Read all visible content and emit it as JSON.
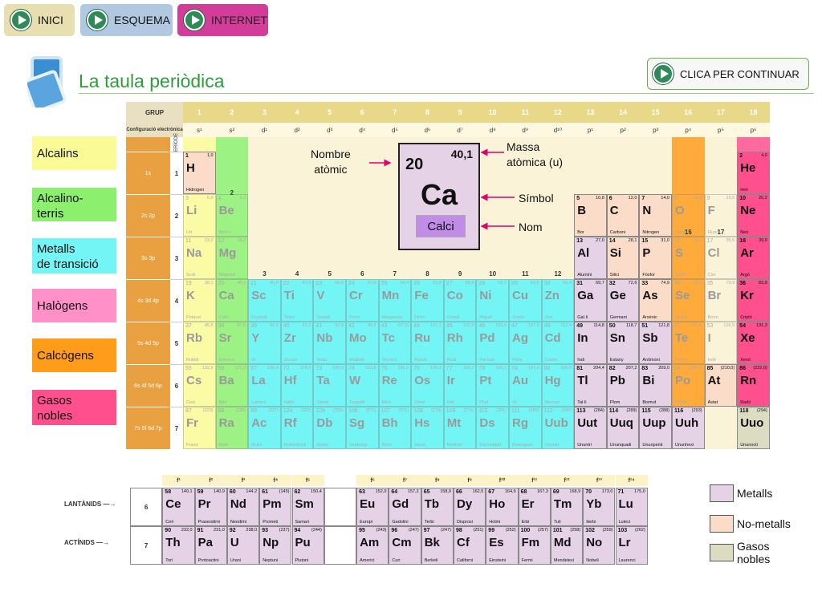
{
  "nav": {
    "inici": "INICI",
    "esquema": "ESQUEMA",
    "internet": "INTERNET"
  },
  "title": "La taula periòdica",
  "continue_label": "CLICA PER CONTINUAR",
  "legend_left": [
    "Alcalins",
    "Alcalino-\nterris",
    "Metalls\nde transició",
    "Halògens",
    "Calcògens",
    "Gasos\nnobles"
  ],
  "legend_right": [
    "Metalls",
    "No-metalls",
    "Gasos\nnobles"
  ],
  "colors": {
    "alkali": "#fafa96",
    "alkaline": "#8cf06e",
    "transition": "#73f5f5",
    "halogen": "#ff91c8",
    "chalcogen": "#ff9c19",
    "noble": "#ff4f8c",
    "metal": "#e6d2e6",
    "nonmetal": "#fadcc8",
    "noblegas": "#dcdcc3",
    "accent": "#2f9e3a"
  },
  "table_headers": {
    "grup": "GRUP",
    "config": "Configuració electrònica",
    "orbitals": "ORBITALS",
    "periode": "PERÍODE",
    "groups": [
      "1",
      "2",
      "3",
      "4",
      "5",
      "6",
      "7",
      "8",
      "9",
      "10",
      "11",
      "12",
      "13",
      "14",
      "15",
      "16",
      "17",
      "18"
    ],
    "configs": [
      "s¹",
      "s²",
      "d¹",
      "d²",
      "d³",
      "d⁴",
      "d⁵",
      "d⁶",
      "d⁷",
      "d⁸",
      "d⁹",
      "d¹⁰",
      "p¹",
      "p²",
      "p³",
      "p⁴",
      "p⁵",
      "p⁶"
    ],
    "orbital_rows": [
      "1s",
      "2s 2p",
      "3s 3p",
      "4s 3d 4p",
      "5s 4d 5p",
      "6s 4f 5d 6p",
      "7s 5f 6d 7p"
    ],
    "periods": [
      "1",
      "2",
      "3",
      "4",
      "5",
      "6",
      "7"
    ],
    "inner_group_labels": [
      "1",
      "2",
      "13",
      "14",
      "15",
      "16",
      "17",
      "18",
      "3",
      "4",
      "5",
      "6",
      "7",
      "8",
      "9",
      "10",
      "11",
      "12"
    ],
    "f_headers": [
      "f¹",
      "f²",
      "f³",
      "f⁴",
      "f⁵",
      "f⁶",
      "f⁷",
      "f⁸",
      "f⁹",
      "f¹⁰",
      "f¹¹",
      "f¹²",
      "f¹³",
      "f¹⁴"
    ]
  },
  "elements": [
    {
      "n": "1",
      "m": "1,0",
      "s": "H",
      "name": "Hidrogen",
      "p": 1,
      "g": 1,
      "c": "nonmetal"
    },
    {
      "n": "2",
      "m": "4,0",
      "s": "He",
      "name": "Heli",
      "p": 1,
      "g": 18,
      "c": "noble"
    },
    {
      "n": "3",
      "m": "6,9",
      "s": "Li",
      "name": "Liti",
      "p": 2,
      "g": 1,
      "c": "alkali",
      "ghost": true
    },
    {
      "n": "4",
      "m": "9,0",
      "s": "Be",
      "name": "Beril·li",
      "p": 2,
      "g": 2,
      "c": "alkaline",
      "ghost": true
    },
    {
      "n": "5",
      "m": "10,8",
      "s": "B",
      "name": "Bor",
      "p": 2,
      "g": 13,
      "c": "nonmetal"
    },
    {
      "n": "6",
      "m": "12,0",
      "s": "C",
      "name": "Carboni",
      "p": 2,
      "g": 14,
      "c": "nonmetal"
    },
    {
      "n": "7",
      "m": "14,0",
      "s": "N",
      "name": "Nitrogen",
      "p": 2,
      "g": 15,
      "c": "nonmetal"
    },
    {
      "n": "8",
      "m": "16,0",
      "s": "O",
      "name": "Oxigen",
      "p": 2,
      "g": 16,
      "c": "chalcogen",
      "ghost": true
    },
    {
      "n": "9",
      "m": "19,0",
      "s": "F",
      "name": "Fluor",
      "p": 2,
      "g": 17,
      "c": "halogen",
      "ghost": true
    },
    {
      "n": "10",
      "m": "20,2",
      "s": "Ne",
      "name": "Neó",
      "p": 2,
      "g": 18,
      "c": "noble"
    },
    {
      "n": "11",
      "m": "23,0",
      "s": "Na",
      "name": "Sodi",
      "p": 3,
      "g": 1,
      "c": "alkali",
      "ghost": true
    },
    {
      "n": "12",
      "m": "24,3",
      "s": "Mg",
      "name": "Magnesi",
      "p": 3,
      "g": 2,
      "c": "alkaline",
      "ghost": true
    },
    {
      "n": "13",
      "m": "27,0",
      "s": "Al",
      "name": "Alumini",
      "p": 3,
      "g": 13,
      "c": "metal"
    },
    {
      "n": "14",
      "m": "28,1",
      "s": "Si",
      "name": "Silici",
      "p": 3,
      "g": 14,
      "c": "nonmetal"
    },
    {
      "n": "15",
      "m": "31,0",
      "s": "P",
      "name": "Fòsfor",
      "p": 3,
      "g": 15,
      "c": "nonmetal"
    },
    {
      "n": "16",
      "m": "32,1",
      "s": "S",
      "name": "Sofre",
      "p": 3,
      "g": 16,
      "c": "chalcogen",
      "ghost": true
    },
    {
      "n": "17",
      "m": "35,5",
      "s": "Cl",
      "name": "Clor",
      "p": 3,
      "g": 17,
      "c": "halogen",
      "ghost": true
    },
    {
      "n": "18",
      "m": "39,9",
      "s": "Ar",
      "name": "Argó",
      "p": 3,
      "g": 18,
      "c": "noble"
    },
    {
      "n": "19",
      "m": "39,1",
      "s": "K",
      "name": "Potassi",
      "p": 4,
      "g": 1,
      "c": "alkali",
      "ghost": true
    },
    {
      "n": "20",
      "m": "40,1",
      "s": "Ca",
      "name": "Calci",
      "p": 4,
      "g": 2,
      "c": "alkaline",
      "ghost": true
    },
    {
      "n": "21",
      "m": "45,0",
      "s": "Sc",
      "name": "Escandi",
      "p": 4,
      "g": 3,
      "c": "transition",
      "ghost": true
    },
    {
      "n": "22",
      "m": "47,9",
      "s": "Ti",
      "name": "Titani",
      "p": 4,
      "g": 4,
      "c": "transition",
      "ghost": true
    },
    {
      "n": "23",
      "m": "50,9",
      "s": "V",
      "name": "Vanadi",
      "p": 4,
      "g": 5,
      "c": "transition",
      "ghost": true
    },
    {
      "n": "24",
      "m": "52,0",
      "s": "Cr",
      "name": "Crom",
      "p": 4,
      "g": 6,
      "c": "transition",
      "ghost": true
    },
    {
      "n": "25",
      "m": "54,9",
      "s": "Mn",
      "name": "Manganès",
      "p": 4,
      "g": 7,
      "c": "transition",
      "ghost": true
    },
    {
      "n": "26",
      "m": "55,8",
      "s": "Fe",
      "name": "Ferro",
      "p": 4,
      "g": 8,
      "c": "transition",
      "ghost": true
    },
    {
      "n": "27",
      "m": "58,9",
      "s": "Co",
      "name": "Cobalt",
      "p": 4,
      "g": 9,
      "c": "transition",
      "ghost": true
    },
    {
      "n": "28",
      "m": "58,7",
      "s": "Ni",
      "name": "Níquel",
      "p": 4,
      "g": 10,
      "c": "transition",
      "ghost": true
    },
    {
      "n": "29",
      "m": "63,5",
      "s": "Cu",
      "name": "Coure",
      "p": 4,
      "g": 11,
      "c": "transition",
      "ghost": true
    },
    {
      "n": "30",
      "m": "65,4",
      "s": "Zn",
      "name": "Zinc",
      "p": 4,
      "g": 12,
      "c": "transition",
      "ghost": true
    },
    {
      "n": "31",
      "m": "69,7",
      "s": "Ga",
      "name": "Gal·li",
      "p": 4,
      "g": 13,
      "c": "metal"
    },
    {
      "n": "32",
      "m": "72,6",
      "s": "Ge",
      "name": "Germani",
      "p": 4,
      "g": 14,
      "c": "metal"
    },
    {
      "n": "33",
      "m": "74,9",
      "s": "As",
      "name": "Arsènic",
      "p": 4,
      "g": 15,
      "c": "nonmetal"
    },
    {
      "n": "34",
      "m": "79,0",
      "s": "Se",
      "name": "Seleni",
      "p": 4,
      "g": 16,
      "c": "chalcogen",
      "ghost": true
    },
    {
      "n": "35",
      "m": "79,9",
      "s": "Br",
      "name": "Brom",
      "p": 4,
      "g": 17,
      "c": "halogen",
      "ghost": true
    },
    {
      "n": "36",
      "m": "83,8",
      "s": "Kr",
      "name": "Criptó",
      "p": 4,
      "g": 18,
      "c": "noble"
    },
    {
      "n": "37",
      "m": "85,5",
      "s": "Rb",
      "name": "Rubidi",
      "p": 5,
      "g": 1,
      "c": "alkali",
      "ghost": true
    },
    {
      "n": "38",
      "m": "87,6",
      "s": "Sr",
      "name": "Estronci",
      "p": 5,
      "g": 2,
      "c": "alkaline",
      "ghost": true
    },
    {
      "n": "39",
      "m": "88,9",
      "s": "Y",
      "name": "Itri",
      "p": 5,
      "g": 3,
      "c": "transition",
      "ghost": true
    },
    {
      "n": "40",
      "m": "91,2",
      "s": "Zr",
      "name": "Zirconi",
      "p": 5,
      "g": 4,
      "c": "transition",
      "ghost": true
    },
    {
      "n": "41",
      "m": "92,9",
      "s": "Nb",
      "name": "Niobi",
      "p": 5,
      "g": 5,
      "c": "transition",
      "ghost": true
    },
    {
      "n": "42",
      "m": "95,9",
      "s": "Mo",
      "name": "Molibdè",
      "p": 5,
      "g": 6,
      "c": "transition",
      "ghost": true
    },
    {
      "n": "43",
      "m": "(97,9)",
      "s": "Tc",
      "name": "Tecneci",
      "p": 5,
      "g": 7,
      "c": "transition",
      "ghost": true
    },
    {
      "n": "44",
      "m": "101,1",
      "s": "Ru",
      "name": "Ruteni",
      "p": 5,
      "g": 8,
      "c": "transition",
      "ghost": true
    },
    {
      "n": "45",
      "m": "102,9",
      "s": "Rh",
      "name": "Rodi",
      "p": 5,
      "g": 9,
      "c": "transition",
      "ghost": true
    },
    {
      "n": "46",
      "m": "106,4",
      "s": "Pd",
      "name": "Pal·ladi",
      "p": 5,
      "g": 10,
      "c": "transition",
      "ghost": true
    },
    {
      "n": "47",
      "m": "107,9",
      "s": "Ag",
      "name": "Plata",
      "p": 5,
      "g": 11,
      "c": "transition",
      "ghost": true
    },
    {
      "n": "48",
      "m": "112,4",
      "s": "Cd",
      "name": "Cadmi",
      "p": 5,
      "g": 12,
      "c": "transition",
      "ghost": true
    },
    {
      "n": "49",
      "m": "114,8",
      "s": "In",
      "name": "Indi",
      "p": 5,
      "g": 13,
      "c": "metal"
    },
    {
      "n": "50",
      "m": "118,7",
      "s": "Sn",
      "name": "Estany",
      "p": 5,
      "g": 14,
      "c": "metal"
    },
    {
      "n": "51",
      "m": "121,8",
      "s": "Sb",
      "name": "Antimoni",
      "p": 5,
      "g": 15,
      "c": "metal"
    },
    {
      "n": "52",
      "m": "127,6",
      "s": "Te",
      "name": "Tel·luri",
      "p": 5,
      "g": 16,
      "c": "chalcogen",
      "ghost": true
    },
    {
      "n": "53",
      "m": "126,9",
      "s": "I",
      "name": "Iode",
      "p": 5,
      "g": 17,
      "c": "halogen",
      "ghost": true
    },
    {
      "n": "54",
      "m": "131,3",
      "s": "Xe",
      "name": "Xenó",
      "p": 5,
      "g": 18,
      "c": "noble"
    },
    {
      "n": "55",
      "m": "132,9",
      "s": "Cs",
      "name": "Cesi",
      "p": 6,
      "g": 1,
      "c": "alkali",
      "ghost": true
    },
    {
      "n": "56",
      "m": "137,3",
      "s": "Ba",
      "name": "Bari",
      "p": 6,
      "g": 2,
      "c": "alkaline",
      "ghost": true
    },
    {
      "n": "57",
      "m": "138,9",
      "s": "La",
      "name": "Lantani",
      "p": 6,
      "g": 3,
      "c": "transition",
      "ghost": true
    },
    {
      "n": "72",
      "m": "178,5",
      "s": "Hf",
      "name": "Hafni",
      "p": 6,
      "g": 4,
      "c": "transition",
      "ghost": true
    },
    {
      "n": "73",
      "m": "180,9",
      "s": "Ta",
      "name": "Tàntal",
      "p": 6,
      "g": 5,
      "c": "transition",
      "ghost": true
    },
    {
      "n": "74",
      "m": "183,8",
      "s": "W",
      "name": "Tungstè",
      "p": 6,
      "g": 6,
      "c": "transition",
      "ghost": true
    },
    {
      "n": "75",
      "m": "186,2",
      "s": "Re",
      "name": "Reni",
      "p": 6,
      "g": 7,
      "c": "transition",
      "ghost": true
    },
    {
      "n": "76",
      "m": "190,2",
      "s": "Os",
      "name": "Osmi",
      "p": 6,
      "g": 8,
      "c": "transition",
      "ghost": true
    },
    {
      "n": "77",
      "m": "192,2",
      "s": "Ir",
      "name": "Iridi",
      "p": 6,
      "g": 9,
      "c": "transition",
      "ghost": true
    },
    {
      "n": "78",
      "m": "195,1",
      "s": "Pt",
      "name": "Platí",
      "p": 6,
      "g": 10,
      "c": "transition",
      "ghost": true
    },
    {
      "n": "79",
      "m": "197,0",
      "s": "Au",
      "name": "Or",
      "p": 6,
      "g": 11,
      "c": "transition",
      "ghost": true
    },
    {
      "n": "80",
      "m": "200,6",
      "s": "Hg",
      "name": "Mercuri",
      "p": 6,
      "g": 12,
      "c": "transition",
      "ghost": true
    },
    {
      "n": "81",
      "m": "204,4",
      "s": "Tl",
      "name": "Tal·li",
      "p": 6,
      "g": 13,
      "c": "metal"
    },
    {
      "n": "82",
      "m": "207,2",
      "s": "Pb",
      "name": "Plom",
      "p": 6,
      "g": 14,
      "c": "metal"
    },
    {
      "n": "83",
      "m": "209,0",
      "s": "Bi",
      "name": "Bismut",
      "p": 6,
      "g": 15,
      "c": "metal"
    },
    {
      "n": "84",
      "m": "(209,0)",
      "s": "Po",
      "name": "Poloni",
      "p": 6,
      "g": 16,
      "c": "chalcogen",
      "ghost": true
    },
    {
      "n": "85",
      "m": "(210,0)",
      "s": "At",
      "name": "Àstat",
      "p": 6,
      "g": 17,
      "c": "nonmetal"
    },
    {
      "n": "86",
      "m": "(222,0)",
      "s": "Rn",
      "name": "Radó",
      "p": 6,
      "g": 18,
      "c": "noble"
    },
    {
      "n": "87",
      "m": "(223)",
      "s": "Fr",
      "name": "Franci",
      "p": 7,
      "g": 1,
      "c": "alkali",
      "ghost": true
    },
    {
      "n": "88",
      "m": "(226)",
      "s": "Ra",
      "name": "Radi",
      "p": 7,
      "g": 2,
      "c": "alkaline",
      "ghost": true
    },
    {
      "n": "89",
      "m": "(227)",
      "s": "Ac",
      "name": "Actini",
      "p": 7,
      "g": 3,
      "c": "transition",
      "ghost": true
    },
    {
      "n": "104",
      "m": "(267)",
      "s": "Rf",
      "name": "Rutherfordi",
      "p": 7,
      "g": 4,
      "c": "transition",
      "ghost": true
    },
    {
      "n": "105",
      "m": "(268)",
      "s": "Db",
      "name": "Dubni",
      "p": 7,
      "g": 5,
      "c": "transition",
      "ghost": true
    },
    {
      "n": "106",
      "m": "(271)",
      "s": "Sg",
      "name": "Seaborgi",
      "p": 7,
      "g": 6,
      "c": "transition",
      "ghost": true
    },
    {
      "n": "107",
      "m": "(272)",
      "s": "Bh",
      "name": "Bohri",
      "p": 7,
      "g": 7,
      "c": "transition",
      "ghost": true
    },
    {
      "n": "108",
      "m": "(270)",
      "s": "Hs",
      "name": "Hassi",
      "p": 7,
      "g": 8,
      "c": "transition",
      "ghost": true
    },
    {
      "n": "109",
      "m": "(276)",
      "s": "Mt",
      "name": "Meitneri",
      "p": 7,
      "g": 9,
      "c": "transition",
      "ghost": true
    },
    {
      "n": "110",
      "m": "(281)",
      "s": "Ds",
      "name": "Darmstadti",
      "p": 7,
      "g": 10,
      "c": "transition",
      "ghost": true
    },
    {
      "n": "111",
      "m": "(280)",
      "s": "Rg",
      "name": "Roentgeni",
      "p": 7,
      "g": 11,
      "c": "transition",
      "ghost": true
    },
    {
      "n": "112",
      "m": "(285)",
      "s": "Uub",
      "name": "Ununbi",
      "p": 7,
      "g": 12,
      "c": "transition",
      "ghost": true
    },
    {
      "n": "113",
      "m": "(284)",
      "s": "Uut",
      "name": "Ununtri",
      "p": 7,
      "g": 13,
      "c": "metal"
    },
    {
      "n": "114",
      "m": "(289)",
      "s": "Uuq",
      "name": "Ununquadi",
      "p": 7,
      "g": 14,
      "c": "metal"
    },
    {
      "n": "115",
      "m": "(288)",
      "s": "Uup",
      "name": "Ununpenti",
      "p": 7,
      "g": 15,
      "c": "metal"
    },
    {
      "n": "116",
      "m": "(293)",
      "s": "Uuh",
      "name": "Ununhexi",
      "p": 7,
      "g": 16,
      "c": "metal"
    },
    {
      "n": "118",
      "m": "(294)",
      "s": "Uuo",
      "name": "Ununocti",
      "p": 7,
      "g": 18,
      "c": "noblegas"
    }
  ],
  "f_block": {
    "row_labels": [
      "LANTÀNIDS",
      "ACTÍNIDS"
    ],
    "periods": [
      "6",
      "7"
    ],
    "lanthanides": [
      {
        "n": "58",
        "m": "140,1",
        "s": "Ce",
        "name": "Ceri",
        "col": 1
      },
      {
        "n": "59",
        "m": "140,9",
        "s": "Pr",
        "name": "Praseodimi",
        "col": 2
      },
      {
        "n": "60",
        "m": "144,2",
        "s": "Nd",
        "name": "Neodimi",
        "col": 3
      },
      {
        "n": "61",
        "m": "(145)",
        "s": "Pm",
        "name": "Prometi",
        "col": 4
      },
      {
        "n": "62",
        "m": "150,4",
        "s": "Sm",
        "name": "Samari",
        "col": 5
      },
      {
        "n": "63",
        "m": "152,0",
        "s": "Eu",
        "name": "Europi",
        "col": 7
      },
      {
        "n": "64",
        "m": "157,2",
        "s": "Gd",
        "name": "Gadolini",
        "col": 8
      },
      {
        "n": "65",
        "m": "158,9",
        "s": "Tb",
        "name": "Terbi",
        "col": 9
      },
      {
        "n": "66",
        "m": "162,5",
        "s": "Dy",
        "name": "Disprosi",
        "col": 10
      },
      {
        "n": "67",
        "m": "164,9",
        "s": "Ho",
        "name": "Holmi",
        "col": 11
      },
      {
        "n": "68",
        "m": "167,3",
        "s": "Er",
        "name": "Erbi",
        "col": 12
      },
      {
        "n": "69",
        "m": "168,9",
        "s": "Tm",
        "name": "Tuli",
        "col": 13
      },
      {
        "n": "70",
        "m": "173,0",
        "s": "Yb",
        "name": "Iterbi",
        "col": 14
      },
      {
        "n": "71",
        "m": "175,0",
        "s": "Lu",
        "name": "Luteci",
        "col": 15
      }
    ],
    "actinides": [
      {
        "n": "90",
        "m": "232,0",
        "s": "Th",
        "name": "Tori",
        "col": 1
      },
      {
        "n": "91",
        "m": "231,0",
        "s": "Pa",
        "name": "Protoactini",
        "col": 2
      },
      {
        "n": "92",
        "m": "238,0",
        "s": "U",
        "name": "Urani",
        "col": 3
      },
      {
        "n": "93",
        "m": "(237)",
        "s": "Np",
        "name": "Neptuni",
        "col": 4
      },
      {
        "n": "94",
        "m": "(244)",
        "s": "Pu",
        "name": "Plutoni",
        "col": 5
      },
      {
        "n": "95",
        "m": "(243)",
        "s": "Am",
        "name": "Americi",
        "col": 7
      },
      {
        "n": "96",
        "m": "(247)",
        "s": "Cm",
        "name": "Curi",
        "col": 8
      },
      {
        "n": "97",
        "m": "(247)",
        "s": "Bk",
        "name": "Berkeli",
        "col": 9
      },
      {
        "n": "98",
        "m": "(251)",
        "s": "Cf",
        "name": "Californi",
        "col": 10
      },
      {
        "n": "99",
        "m": "(252)",
        "s": "Es",
        "name": "Einsteini",
        "col": 11
      },
      {
        "n": "100",
        "m": "(257)",
        "s": "Fm",
        "name": "Fermi",
        "col": 12
      },
      {
        "n": "101",
        "m": "(258)",
        "s": "Md",
        "name": "Mendelevi",
        "col": 13
      },
      {
        "n": "102",
        "m": "(259)",
        "s": "No",
        "name": "Nobeli",
        "col": 14
      },
      {
        "n": "103",
        "m": "(262)",
        "s": "Lr",
        "name": "Laurenci",
        "col": 15
      }
    ]
  },
  "callout": {
    "number": "20",
    "mass": "40,1",
    "symbol": "Ca",
    "name": "Calci",
    "label_number": "Nombre\natòmic",
    "label_mass": "Massa\natòmica (u)",
    "label_symbol": "Símbol",
    "label_name": "Nom"
  }
}
